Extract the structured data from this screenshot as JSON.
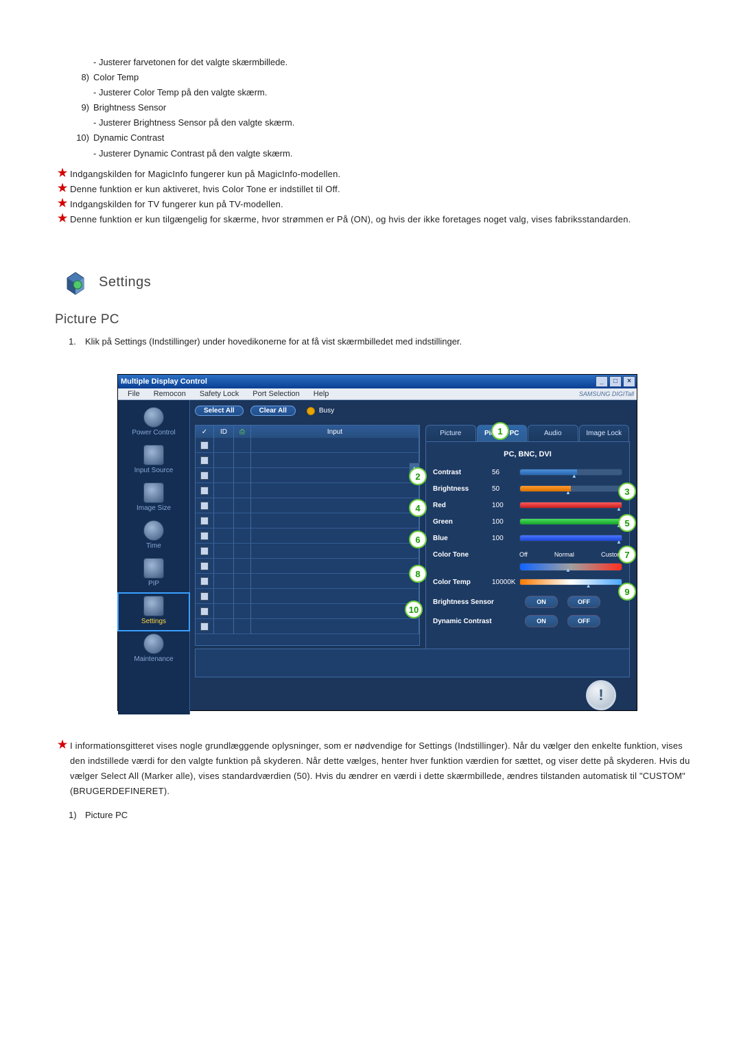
{
  "doclist": {
    "r7desc": "- Justerer farvetonen for det valgte skærmbillede.",
    "r8num": "8)",
    "r8title": "Color Temp",
    "r8desc": "- Justerer Color Temp på den valgte skærm.",
    "r9num": "9)",
    "r9title": "Brightness Sensor",
    "r9desc": "- Justerer Brightness Sensor på den valgte skærm.",
    "r10num": "10)",
    "r10title": "Dynamic Contrast",
    "r10desc": "- Justerer Dynamic Contrast på den valgte skærm."
  },
  "notes": {
    "n1": "Indgangskilden for MagicInfo fungerer kun på MagicInfo-modellen.",
    "n2": "Denne funktion er kun aktiveret, hvis Color Tone er indstillet til Off.",
    "n3": "Indgangskilden for TV fungerer kun på TV-modellen.",
    "n4": "Denne funktion er kun tilgængelig for skærme, hvor strømmen er På (ON), og hvis der ikke foretages noget valg, vises fabriksstandarden."
  },
  "settings_title": "Settings",
  "picture_pc_title": "Picture PC",
  "intro": {
    "num": "1.",
    "text": "Klik på Settings (Indstillinger) under hovedikonerne for at få vist skærmbilledet med indstillinger."
  },
  "mdc": {
    "title": "Multiple Display Control",
    "menu": {
      "file": "File",
      "remocon": "Remocon",
      "safety": "Safety Lock",
      "port": "Port Selection",
      "help": "Help"
    },
    "brand": "SAMSUNG DIGITall",
    "sidebar": {
      "power": "Power Control",
      "input": "Input Source",
      "image": "Image Size",
      "time": "Time",
      "pip": "PIP",
      "settings": "Settings",
      "maint": "Maintenance"
    },
    "top": {
      "select_all": "Select All",
      "clear_all": "Clear All",
      "busy": "Busy"
    },
    "grid": {
      "chk": "✓",
      "id": "ID",
      "st_icon": "⎙",
      "input": "Input"
    },
    "tabs": {
      "picture": "Picture",
      "picturepc": "Picture PC",
      "audio": "Audio",
      "imagelock": "Image Lock"
    },
    "panel": {
      "sub": "PC, BNC, DVI",
      "contrast_label": "Contrast",
      "contrast_val": "56",
      "brightness_label": "Brightness",
      "brightness_val": "50",
      "red_label": "Red",
      "red_val": "100",
      "green_label": "Green",
      "green_val": "100",
      "blue_label": "Blue",
      "blue_val": "100",
      "colortone_label": "Color Tone",
      "ct_off": "Off",
      "ct_normal": "Normal",
      "ct_custom": "Custom",
      "colortemp_label": "Color Temp",
      "colortemp_val": "10000K",
      "brsensor_label": "Brightness Sensor",
      "dyncon_label": "Dynamic Contrast",
      "on": "ON",
      "off": "OFF"
    },
    "markers": {
      "m1": "1",
      "m2": "2",
      "m3": "3",
      "m4": "4",
      "m5": "5",
      "m6": "6",
      "m7": "7",
      "m8": "8",
      "m9": "9",
      "m10": "10"
    }
  },
  "after_note": "I informationsgitteret vises nogle grundlæggende oplysninger, som er nødvendige for Settings (Indstillinger). Når du vælger den enkelte funktion, vises den indstillede værdi for den valgte funktion på skyderen. Når dette vælges, henter hver funktion værdien for sættet, og viser dette på skyderen. Hvis du vælger Select All (Marker alle), vises standardværdien (50). Hvis du ændrer en værdi i dette skærmbillede, ændres tilstanden automatisk til \"CUSTOM\" (BRUGERDEFINERET).",
  "after_item": {
    "num": "1)",
    "text": "Picture PC"
  }
}
